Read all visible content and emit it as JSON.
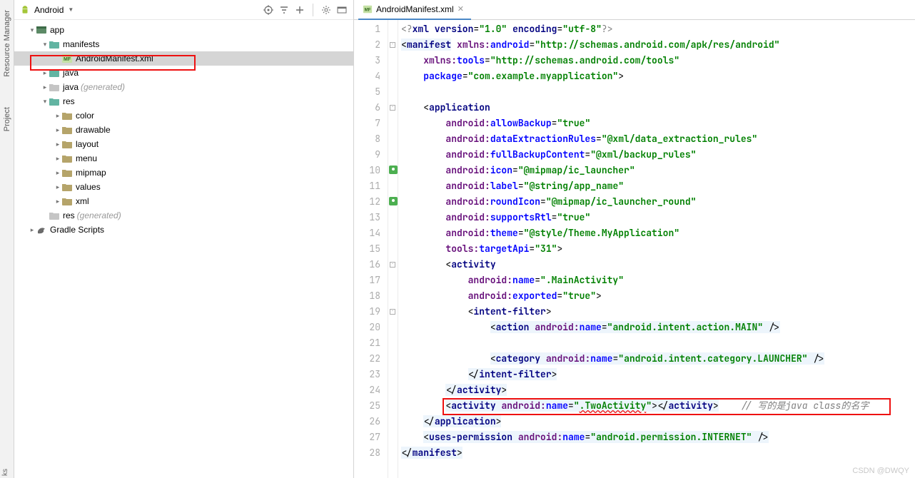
{
  "leftRail": {
    "items": [
      "Resource Manager",
      "Project"
    ],
    "bottom": "ks"
  },
  "projectPanel": {
    "dropdown": "Android",
    "tree": [
      {
        "depth": 0,
        "arrow": "▾",
        "icon": "app",
        "label": "app",
        "gen": "",
        "sel": false
      },
      {
        "depth": 1,
        "arrow": "▾",
        "icon": "teal",
        "label": "manifests",
        "gen": "",
        "sel": false
      },
      {
        "depth": 2,
        "arrow": "",
        "icon": "mf",
        "label": "AndroidManifest.xml",
        "gen": "",
        "sel": true,
        "hl": true
      },
      {
        "depth": 1,
        "arrow": "▸",
        "icon": "teal",
        "label": "java",
        "gen": "",
        "sel": false
      },
      {
        "depth": 1,
        "arrow": "▸",
        "icon": "grey",
        "label": "java",
        "gen": "(generated)",
        "sel": false
      },
      {
        "depth": 1,
        "arrow": "▾",
        "icon": "teal",
        "label": "res",
        "gen": "",
        "sel": false
      },
      {
        "depth": 2,
        "arrow": "▸",
        "icon": "folder",
        "label": "color",
        "gen": "",
        "sel": false
      },
      {
        "depth": 2,
        "arrow": "▸",
        "icon": "folder",
        "label": "drawable",
        "gen": "",
        "sel": false
      },
      {
        "depth": 2,
        "arrow": "▸",
        "icon": "folder",
        "label": "layout",
        "gen": "",
        "sel": false
      },
      {
        "depth": 2,
        "arrow": "▸",
        "icon": "folder",
        "label": "menu",
        "gen": "",
        "sel": false
      },
      {
        "depth": 2,
        "arrow": "▸",
        "icon": "folder",
        "label": "mipmap",
        "gen": "",
        "sel": false
      },
      {
        "depth": 2,
        "arrow": "▸",
        "icon": "folder",
        "label": "values",
        "gen": "",
        "sel": false
      },
      {
        "depth": 2,
        "arrow": "▸",
        "icon": "folder",
        "label": "xml",
        "gen": "",
        "sel": false
      },
      {
        "depth": 1,
        "arrow": "",
        "icon": "grey",
        "label": "res",
        "gen": "(generated)",
        "sel": false
      },
      {
        "depth": 0,
        "arrow": "▸",
        "icon": "gradle",
        "label": "Gradle Scripts",
        "gen": "",
        "sel": false
      }
    ]
  },
  "editor": {
    "tab": {
      "label": "AndroidManifest.xml"
    },
    "lines": [
      {
        "n": 1,
        "fold": "",
        "html": "<span class='c-info'>&lt;?</span><span class='c-tag'>xml version</span><span class='c-punc'>=</span><span class='c-str'>\"1.0\"</span> <span class='c-tag'>encoding</span><span class='c-punc'>=</span><span class='c-str'>\"utf-8\"</span><span class='c-info'>?&gt;</span>"
      },
      {
        "n": 2,
        "fold": "-",
        "bg": true,
        "html": "<span class='hl-bg'><span class='c-punc'>&lt;</span><span class='c-tag'>manifest</span></span> <span class='c-ns'>xmlns:</span><span class='c-attr'>android</span><span class='c-punc'>=</span><span class='c-str'>\"http://schemas.android.com/apk/res/android\"</span>"
      },
      {
        "n": 3,
        "fold": "",
        "html": "    <span class='c-ns'>xmlns:</span><span class='c-attr'>tools</span><span class='c-punc'>=</span><span class='c-str'>\"http://schemas.android.com/tools\"</span>"
      },
      {
        "n": 4,
        "fold": "",
        "html": "    <span class='c-attr'>package</span><span class='c-punc'>=</span><span class='c-str'>\"com.example.myapplication\"</span><span class='c-punc'>&gt;</span>"
      },
      {
        "n": 5,
        "fold": "",
        "html": " "
      },
      {
        "n": 6,
        "fold": "-",
        "html": "    <span class='c-punc'>&lt;</span><span class='c-tag'>application</span>"
      },
      {
        "n": 7,
        "fold": "",
        "html": "        <span class='c-ns'>android:</span><span class='c-attr'>allowBackup</span><span class='c-punc'>=</span><span class='c-str'>\"true\"</span>"
      },
      {
        "n": 8,
        "fold": "",
        "html": "        <span class='c-ns'>android:</span><span class='c-attr'>dataExtractionRules</span><span class='c-punc'>=</span><span class='c-str'>\"@xml/data_extraction_rules\"</span>"
      },
      {
        "n": 9,
        "fold": "",
        "html": "        <span class='c-ns'>android:</span><span class='c-attr'>fullBackupContent</span><span class='c-punc'>=</span><span class='c-str'>\"@xml/backup_rules\"</span>"
      },
      {
        "n": 10,
        "fold": "",
        "mark": "img",
        "html": "        <span class='c-ns'>android:</span><span class='c-attr'>icon</span><span class='c-punc'>=</span><span class='c-str'>\"@mipmap/ic_launcher\"</span>"
      },
      {
        "n": 11,
        "fold": "",
        "html": "        <span class='c-ns'>android:</span><span class='c-attr'>label</span><span class='c-punc'>=</span><span class='c-str'>\"@string/app_name\"</span>"
      },
      {
        "n": 12,
        "fold": "",
        "mark": "img",
        "html": "        <span class='c-ns'>android:</span><span class='c-attr'>roundIcon</span><span class='c-punc'>=</span><span class='c-str'>\"@mipmap/ic_launcher_round\"</span>"
      },
      {
        "n": 13,
        "fold": "",
        "html": "        <span class='c-ns'>android:</span><span class='c-attr'>supportsRtl</span><span class='c-punc'>=</span><span class='c-str'>\"true\"</span>"
      },
      {
        "n": 14,
        "fold": "",
        "html": "        <span class='c-ns'>android:</span><span class='c-attr'>theme</span><span class='c-punc'>=</span><span class='c-str'>\"@style/Theme.MyApplication\"</span>"
      },
      {
        "n": 15,
        "fold": "",
        "html": "        <span class='c-ns'>tools:</span><span class='c-attr'>targetApi</span><span class='c-punc'>=</span><span class='c-str'>\"31\"</span><span class='c-punc'>&gt;</span>"
      },
      {
        "n": 16,
        "fold": "-",
        "html": "        <span class='c-punc'>&lt;</span><span class='c-tag'>activity</span>"
      },
      {
        "n": 17,
        "fold": "",
        "html": "            <span class='c-ns'>android:</span><span class='c-attr'>name</span><span class='c-punc'>=</span><span class='c-str'>\".MainActivity\"</span>"
      },
      {
        "n": 18,
        "fold": "",
        "html": "            <span class='c-ns'>android:</span><span class='c-attr'>exported</span><span class='c-punc'>=</span><span class='c-str'>\"true\"</span><span class='c-punc'>&gt;</span>"
      },
      {
        "n": 19,
        "fold": "-",
        "html": "            <span class='c-punc'>&lt;</span><span class='c-tag'>intent-filter</span><span class='c-punc'>&gt;</span>"
      },
      {
        "n": 20,
        "fold": "",
        "html": "                <span class='hl-bg'><span class='c-punc'>&lt;</span><span class='c-tag'>action</span> <span class='c-ns'>android:</span><span class='c-attr'>name</span><span class='c-punc'>=</span><span class='c-str'>\"android.intent.action.MAIN\"</span> <span class='c-punc'>/&gt;</span></span>"
      },
      {
        "n": 21,
        "fold": "",
        "html": " "
      },
      {
        "n": 22,
        "fold": "",
        "html": "                <span class='hl-bg'><span class='c-punc'>&lt;</span><span class='c-tag'>category</span> <span class='c-ns'>android:</span><span class='c-attr'>name</span><span class='c-punc'>=</span><span class='c-str'>\"android.intent.category.LAUNCHER\"</span> <span class='c-punc'>/&gt;</span></span>"
      },
      {
        "n": 23,
        "fold": "",
        "html": "            <span class='hl-bg'><span class='c-punc'>&lt;/</span><span class='c-tag'>intent-filter</span><span class='c-punc'>&gt;</span></span>"
      },
      {
        "n": 24,
        "fold": "",
        "html": "        <span class='hl-bg'><span class='c-punc'>&lt;/</span><span class='c-tag'>activity</span><span class='c-punc'>&gt;</span></span>"
      },
      {
        "n": 25,
        "fold": "",
        "html": "        <span class='hl-bg'><span class='c-punc'>&lt;</span><span class='c-tag'>activity</span> <span class='c-ns'>android:</span><span class='c-attr'>name</span><span class='c-punc'>=</span><span class='c-str'>\"<span class='c-err'>.TwoActivity</span>\"</span><span class='c-punc'>&gt;&lt;/</span><span class='c-tag'>activity</span><span class='c-punc'>&gt;</span></span>    <span class='c-cmt'>// 写的是java class的名字</span>"
      },
      {
        "n": 26,
        "fold": "",
        "html": "    <span class='hl-bg'><span class='c-punc'>&lt;/</span><span class='c-tag'>application</span><span class='c-punc'>&gt;</span></span>"
      },
      {
        "n": 27,
        "fold": "",
        "html": "    <span class='hl-bg'><span class='c-punc'>&lt;</span><span class='c-tag'>uses-permission</span> <span class='c-ns'>android:</span><span class='c-attr'>name</span><span class='c-punc'>=</span><span class='c-str'>\"android.permission.INTERNET\"</span> <span class='c-punc'>/&gt;</span></span>"
      },
      {
        "n": 28,
        "fold": "",
        "html": "<span class='hl-bg'><span class='c-punc'>&lt;/</span><span class='c-tag'>manifest</span><span class='c-punc'>&gt;</span></span>"
      }
    ]
  },
  "watermark": "CSDN @DWQY"
}
